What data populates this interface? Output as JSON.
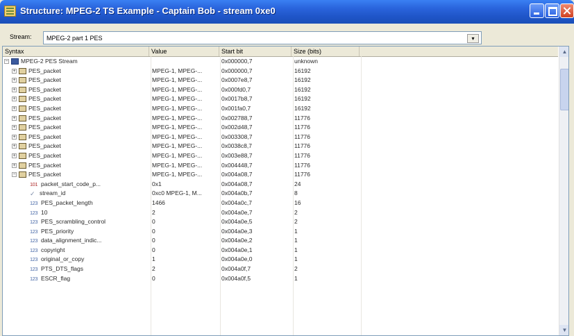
{
  "window": {
    "title": "Structure: MPEG-2 TS Example - Captain Bob - stream 0xe0"
  },
  "stream": {
    "label": "Stream:",
    "value": "MPEG-2 part 1 PES",
    "dropdown_glyph": "▾"
  },
  "columns": {
    "syntax": "Syntax",
    "value": "Value",
    "start": "Start bit",
    "size": "Size (bits)"
  },
  "rows": [
    {
      "name": "MPEG-2 PES Stream",
      "value": "",
      "start": "0x000000,7",
      "size": "unknown",
      "level": 0,
      "icon": "stream",
      "exp": "−"
    },
    {
      "name": "PES_packet",
      "value": "MPEG-1, MPEG-...",
      "start": "0x000000,7",
      "size": "16192",
      "level": 1,
      "icon": "folder",
      "exp": "+"
    },
    {
      "name": "PES_packet",
      "value": "MPEG-1, MPEG-...",
      "start": "0x0007e8,7",
      "size": "16192",
      "level": 1,
      "icon": "folder",
      "exp": "+"
    },
    {
      "name": "PES_packet",
      "value": "MPEG-1, MPEG-...",
      "start": "0x000fd0,7",
      "size": "16192",
      "level": 1,
      "icon": "folder",
      "exp": "+"
    },
    {
      "name": "PES_packet",
      "value": "MPEG-1, MPEG-...",
      "start": "0x0017b8,7",
      "size": "16192",
      "level": 1,
      "icon": "folder",
      "exp": "+"
    },
    {
      "name": "PES_packet",
      "value": "MPEG-1, MPEG-...",
      "start": "0x001fa0,7",
      "size": "16192",
      "level": 1,
      "icon": "folder",
      "exp": "+"
    },
    {
      "name": "PES_packet",
      "value": "MPEG-1, MPEG-...",
      "start": "0x002788,7",
      "size": "11776",
      "level": 1,
      "icon": "folder",
      "exp": "+"
    },
    {
      "name": "PES_packet",
      "value": "MPEG-1, MPEG-...",
      "start": "0x002d48,7",
      "size": "11776",
      "level": 1,
      "icon": "folder",
      "exp": "+"
    },
    {
      "name": "PES_packet",
      "value": "MPEG-1, MPEG-...",
      "start": "0x003308,7",
      "size": "11776",
      "level": 1,
      "icon": "folder",
      "exp": "+"
    },
    {
      "name": "PES_packet",
      "value": "MPEG-1, MPEG-...",
      "start": "0x0038c8,7",
      "size": "11776",
      "level": 1,
      "icon": "folder",
      "exp": "+"
    },
    {
      "name": "PES_packet",
      "value": "MPEG-1, MPEG-...",
      "start": "0x003e88,7",
      "size": "11776",
      "level": 1,
      "icon": "folder",
      "exp": "+"
    },
    {
      "name": "PES_packet",
      "value": "MPEG-1, MPEG-...",
      "start": "0x004448,7",
      "size": "11776",
      "level": 1,
      "icon": "folder",
      "exp": "+"
    },
    {
      "name": "PES_packet",
      "value": "MPEG-1, MPEG-...",
      "start": "0x004a08,7",
      "size": "11776",
      "level": 1,
      "icon": "folder",
      "exp": "−"
    },
    {
      "name": "packet_start_code_p...",
      "value": "0x1",
      "start": "0x004a08,7",
      "size": "24",
      "level": 2,
      "icon": "hex"
    },
    {
      "name": "stream_id",
      "value": "0xc0 MPEG-1, M...",
      "start": "0x004a0b,7",
      "size": "8",
      "level": 2,
      "icon": "check"
    },
    {
      "name": "PES_packet_length",
      "value": "1466",
      "start": "0x004a0c,7",
      "size": "16",
      "level": 2,
      "icon": "num"
    },
    {
      "name": "10",
      "value": "2",
      "start": "0x004a0e,7",
      "size": "2",
      "level": 2,
      "icon": "num"
    },
    {
      "name": "PES_scrambling_control",
      "value": "0",
      "start": "0x004a0e,5",
      "size": "2",
      "level": 2,
      "icon": "num"
    },
    {
      "name": "PES_priority",
      "value": "0",
      "start": "0x004a0e,3",
      "size": "1",
      "level": 2,
      "icon": "num"
    },
    {
      "name": "data_alignment_indic...",
      "value": "0",
      "start": "0x004a0e,2",
      "size": "1",
      "level": 2,
      "icon": "num"
    },
    {
      "name": "copyright",
      "value": "0",
      "start": "0x004a0e,1",
      "size": "1",
      "level": 2,
      "icon": "num"
    },
    {
      "name": "original_or_copy",
      "value": "1",
      "start": "0x004a0e,0",
      "size": "1",
      "level": 2,
      "icon": "num"
    },
    {
      "name": "PTS_DTS_flags",
      "value": "2",
      "start": "0x004a0f,7",
      "size": "2",
      "level": 2,
      "icon": "num"
    },
    {
      "name": "ESCR_flag",
      "value": "0",
      "start": "0x004a0f,5",
      "size": "1",
      "level": 2,
      "icon": "num"
    }
  ],
  "icons": {
    "num": "123",
    "hex": "101",
    "check": "✓"
  },
  "scrollbar": {
    "up_glyph": "▲",
    "down_glyph": "▼"
  }
}
